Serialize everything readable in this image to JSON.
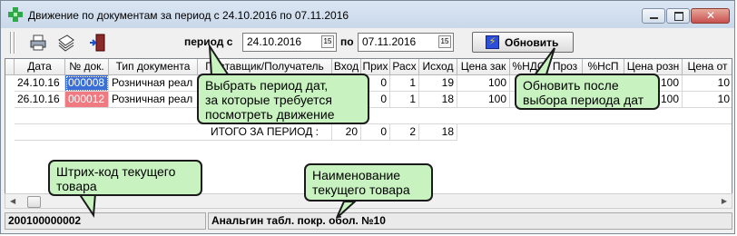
{
  "window": {
    "title": "Движение по документам за период с 24.10.2016 по 07.11.2016"
  },
  "toolbar": {
    "print_icon": "printer-icon",
    "edit_icon": "edit-icon",
    "exit_icon": "exit-door-icon",
    "period_from_label": "период с",
    "period_from_value": "24.10.2016",
    "period_to_label": "по",
    "period_to_value": "07.11.2016",
    "calendar_glyph": "15",
    "refresh_label": "Обновить",
    "refresh_icon": "lightning-icon"
  },
  "grid": {
    "columns": [
      "Дата",
      "№ док.",
      "Тип документа",
      "Поставщик/Получатель",
      "Вход",
      "Прих",
      "Расх",
      "Исход",
      "Цена зак",
      "%НДС",
      "Проз",
      "%НсП",
      "Цена розн",
      "Цена от"
    ],
    "rows": [
      {
        "date": "24.10.16",
        "doc": "000008",
        "type": "Розничная реал",
        "in": "",
        "prih": "0",
        "rash": "1",
        "out": "19",
        "price_buy": "100",
        "price_sale": "100",
        "price_from": "10"
      },
      {
        "date": "26.10.16",
        "doc": "000012",
        "type": "Розничная реал",
        "in": "",
        "prih": "0",
        "rash": "1",
        "out": "18",
        "price_buy": "100",
        "price_sale": "100",
        "price_from": "10"
      }
    ],
    "total": {
      "label": "ИТОГО ЗА ПЕРИОД :",
      "in": "20",
      "prih": "0",
      "rash": "2",
      "out": "18"
    }
  },
  "status": {
    "barcode": "200100000002",
    "product_name": "Анальгин табл. покр. обол. №10"
  },
  "callouts": {
    "period": "Выбрать период дат,\nза которые требуется\nпосмотреть движение",
    "refresh": "Обновить после\nвыбора периода дат",
    "barcode": "Штрих-код текущего\nтовара",
    "product": "Наименование\nтекущего товара"
  },
  "colors": {
    "selected_doc": "#3a6fd8",
    "pink_doc": "#f07a82",
    "callout_bg": "#c8f3c0"
  }
}
